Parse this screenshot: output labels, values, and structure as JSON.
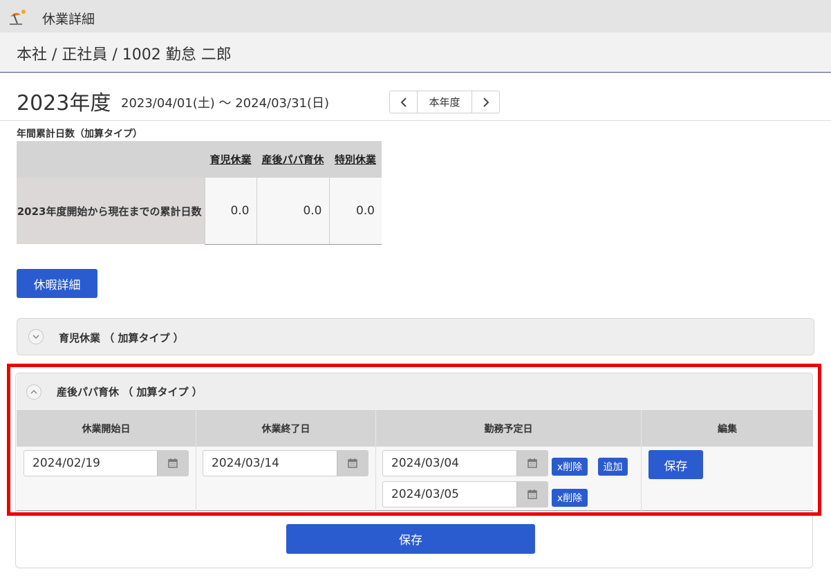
{
  "app": {
    "title": "休業詳細",
    "icon": "beach-umbrella-icon"
  },
  "breadcrumb": "本社 / 正社員 / 1002 勤怠 二郎",
  "fiscal": {
    "year_label": "2023年度",
    "range": "2023/04/01(土) ～ 2024/03/31(日)",
    "prev_icon": "chevron-left-icon",
    "current_label": "本年度",
    "next_icon": "chevron-right-icon"
  },
  "summary": {
    "section_label": "年間累計日数（加算タイプ）",
    "columns": [
      "育児休業",
      "産後パパ育休",
      "特別休業"
    ],
    "row_label": "2023年度開始から現在までの累計日数",
    "values": [
      "0.0",
      "0.0",
      "0.0"
    ]
  },
  "buttons": {
    "leave_detail": "休暇詳細",
    "save": "保存"
  },
  "accordions": [
    {
      "title": "育児休業 （ 加算タイプ ）",
      "expanded": false
    },
    {
      "title": "産後パパ育休 （ 加算タイプ ）",
      "expanded": true
    }
  ],
  "papa_leave": {
    "headers": [
      "休業開始日",
      "休業終了日",
      "勤務予定日",
      "編集"
    ],
    "start_date": "2024/02/19",
    "end_date": "2024/03/14",
    "work_days": [
      "2024/03/04",
      "2024/03/05"
    ],
    "delete_label": "x削除",
    "add_label": "追加",
    "row_save_label": "保存"
  },
  "colors": {
    "accent_blue": "#2a5ccf",
    "highlight_red": "#ee0000",
    "header_gray": "#d4d4d4"
  }
}
